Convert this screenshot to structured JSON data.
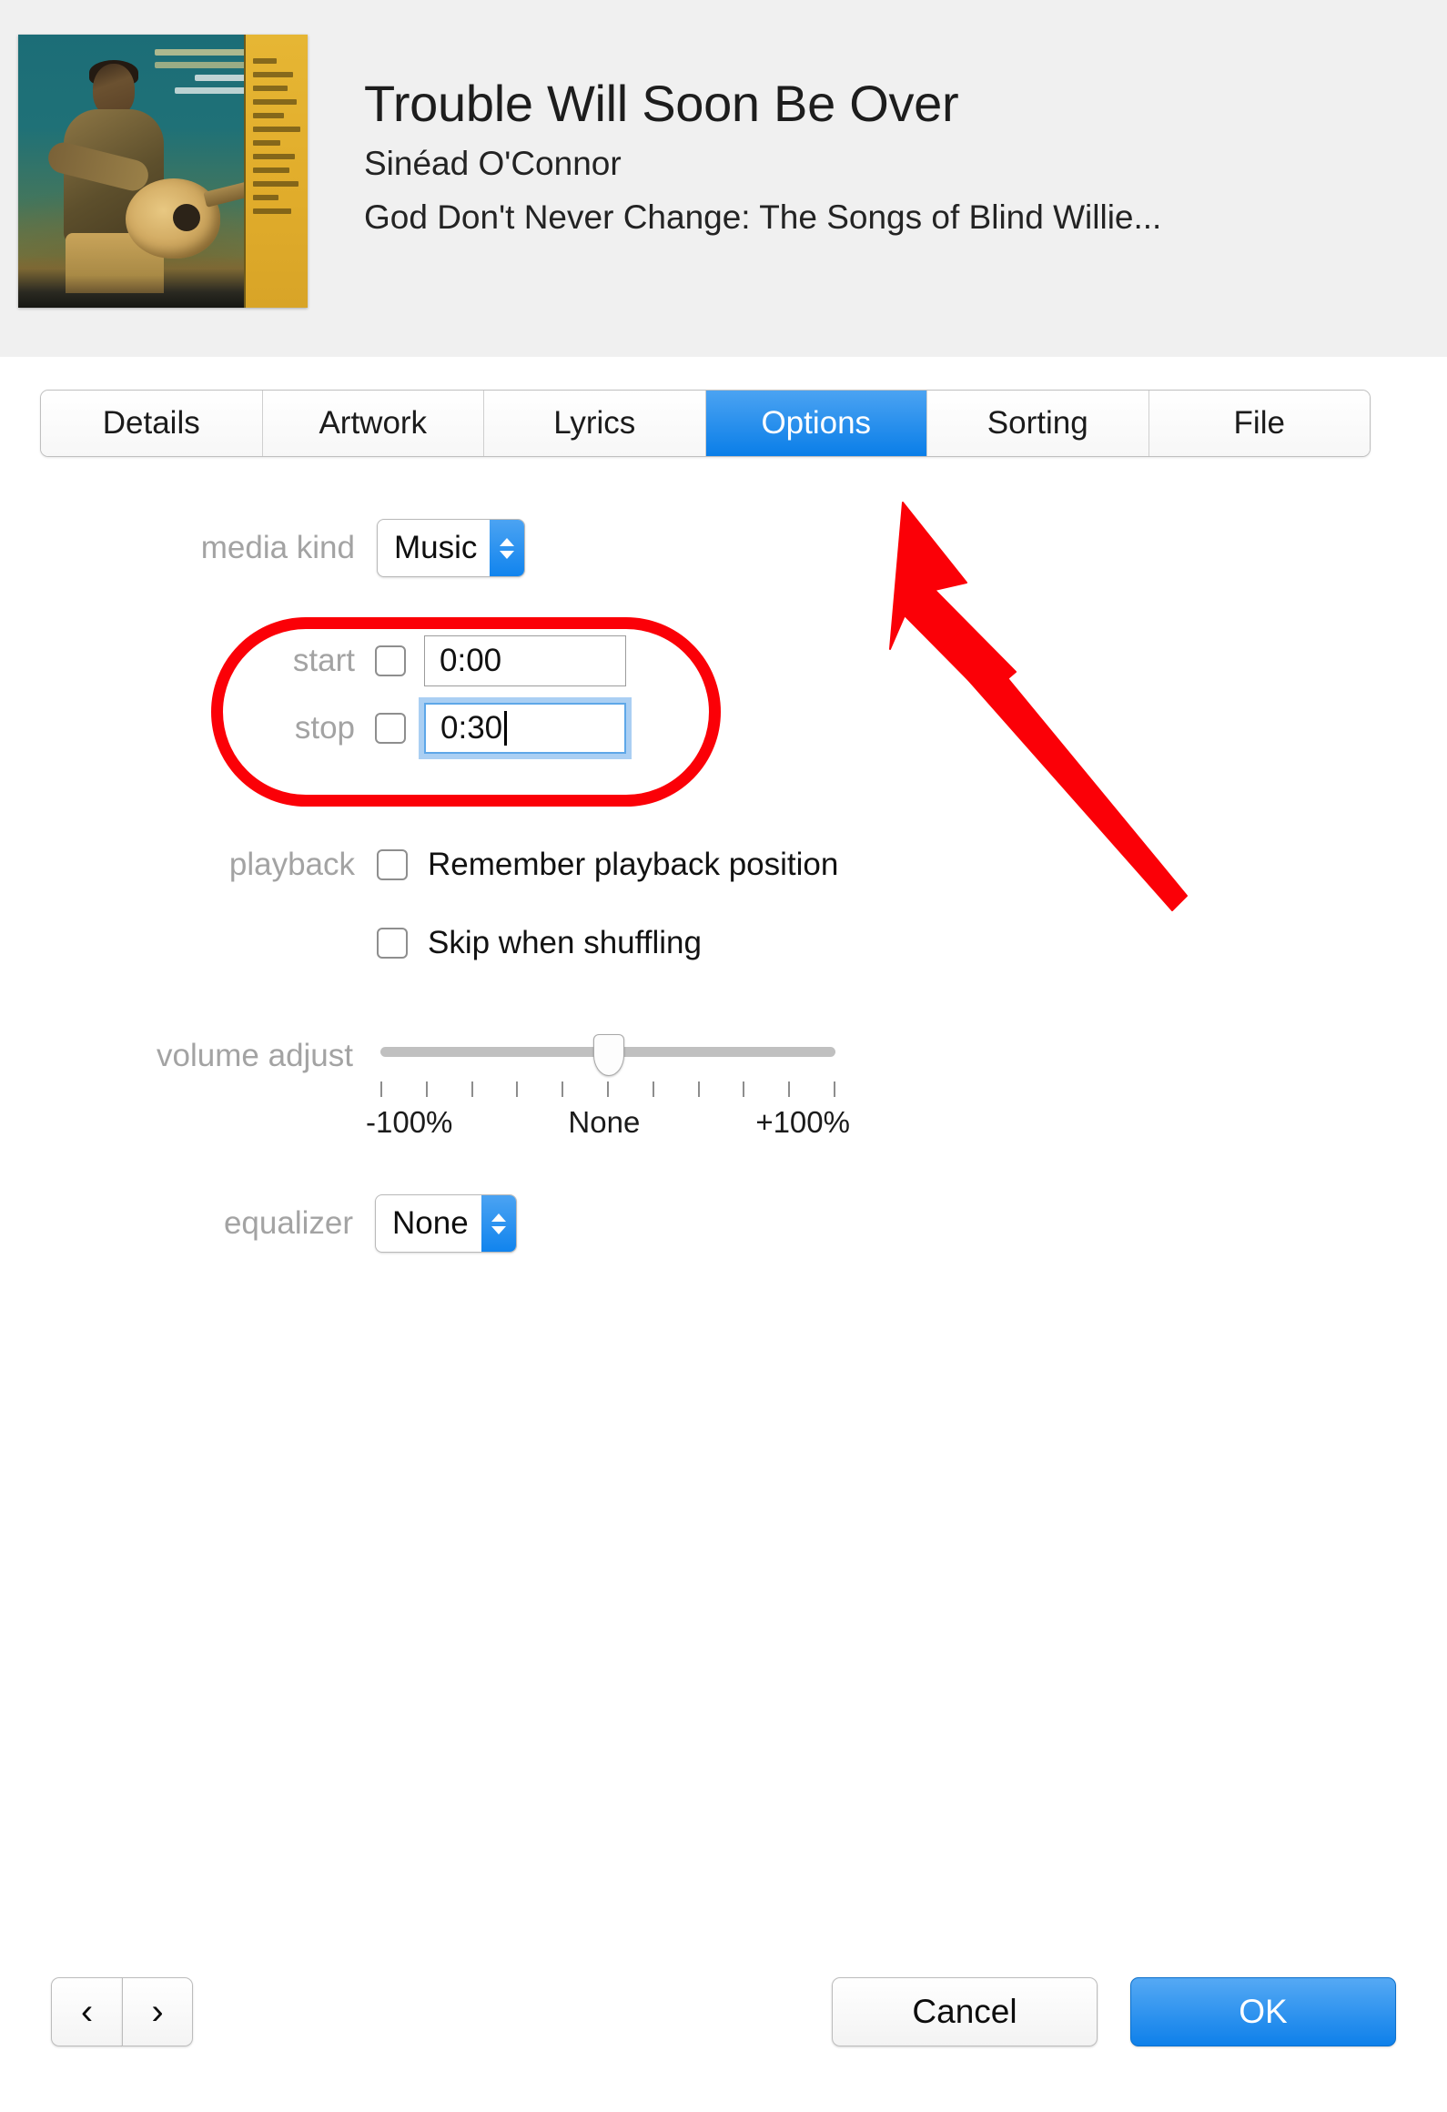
{
  "header": {
    "title": "Trouble Will Soon Be Over",
    "artist": "Sinéad O'Connor",
    "album": "God Don't Never Change: The Songs of Blind Willie...",
    "artwork_name": "album-artwork",
    "artwork_bg_color": "#1f7177",
    "artwork_strip_color": "#e2ae2c"
  },
  "tabs": {
    "items": [
      {
        "label": "Details",
        "active": false
      },
      {
        "label": "Artwork",
        "active": false
      },
      {
        "label": "Lyrics",
        "active": false
      },
      {
        "label": "Options",
        "active": true
      },
      {
        "label": "Sorting",
        "active": false
      },
      {
        "label": "File",
        "active": false
      }
    ],
    "active_color": "#0a7ee8"
  },
  "options": {
    "media_kind": {
      "label": "media kind",
      "value": "Music"
    },
    "start": {
      "label": "start",
      "value": "0:00",
      "checked": false,
      "focused": false
    },
    "stop": {
      "label": "stop",
      "value": "0:30",
      "checked": false,
      "focused": true
    },
    "playback": {
      "label": "playback",
      "remember_position": {
        "label": "Remember playback position",
        "checked": false
      },
      "skip_shuffling": {
        "label": "Skip when shuffling",
        "checked": false
      }
    },
    "volume_adjust": {
      "label": "volume adjust",
      "min_label": "-100%",
      "center_label": "None",
      "max_label": "+100%",
      "value": "None",
      "tick_count": 11
    },
    "equalizer": {
      "label": "equalizer",
      "value": "None"
    }
  },
  "footer": {
    "prev_label": "‹",
    "next_label": "›",
    "cancel_label": "Cancel",
    "ok_label": "OK",
    "ok_color": "#0e80ea"
  },
  "annotations": {
    "highlight_color": "#fb0007",
    "ellipse_target": "start-stop-fields",
    "arrow_target": "tab-options"
  }
}
